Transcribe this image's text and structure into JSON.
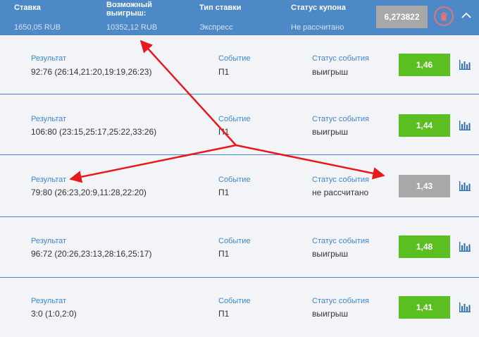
{
  "header": {
    "stake_label": "Ставка",
    "stake_value": "1650,05 RUB",
    "win_label_line1": "Возможный",
    "win_label_line2": "выигрыш:",
    "win_value": "10352,12 RUB",
    "type_label": "Тип ставки",
    "type_value": "Экспресс",
    "status_label": "Статус купона",
    "status_value": "Не рассчитано",
    "total_coef": "6,273822"
  },
  "columns": {
    "result": "Результат",
    "event": "Событие",
    "event_status": "Статус события"
  },
  "rows": [
    {
      "result": "92:76 (26:14,21:20,19:19,26:23)",
      "event": "П1",
      "status": "выигрыш",
      "coef": "1,46"
    },
    {
      "result": "106:80 (23:15,25:17,25:22,33:26)",
      "event": "П1",
      "status": "выигрыш",
      "coef": "1,44"
    },
    {
      "result": "79:80 (26:23,20:9,11:28,22:20)",
      "event": "П1",
      "status": "не рассчитано",
      "coef": "1,43"
    },
    {
      "result": "96:72 (20:26,23:13,28:16,25:17)",
      "event": "П1",
      "status": "выигрыш",
      "coef": "1,48"
    },
    {
      "result": "3:0 (1:0,2:0)",
      "event": "П1",
      "status": "выигрыш",
      "coef": "1,41"
    }
  ],
  "colors": {
    "header_bg": "#4e89c7",
    "win_green": "#5bbf21",
    "pending_gray": "#a8a8a8",
    "accent_blue": "#3f86cf",
    "annotation_red": "#e8191b"
  },
  "icons": {
    "trash": "trash-icon",
    "chevron": "chevron-up-icon",
    "stats": "bar-chart-icon"
  }
}
